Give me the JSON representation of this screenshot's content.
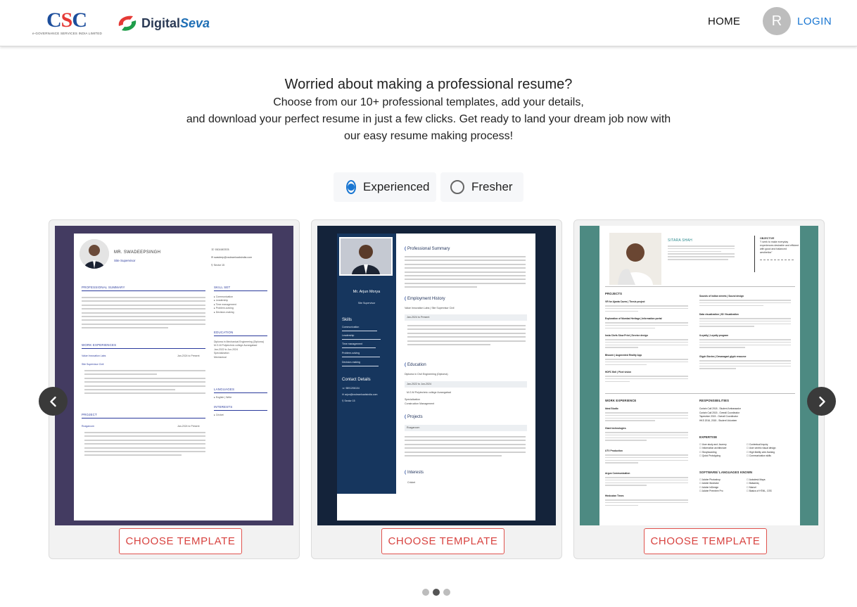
{
  "nav": {
    "csc_logo": "CSC",
    "csc_logo_sub": "e-GOVERNANCE SERVICES INDIA LIMITED",
    "digitalseva_brand": "Digital",
    "digitalseva_brand_accent": "Seva",
    "home_label": "HOME",
    "avatar_initial": "R",
    "login_label": "LOGIN"
  },
  "hero": {
    "title": "Worried about making a professional resume?",
    "line1": "Choose from our 10+ professional templates, add your details,",
    "line2": "and download your perfect resume in just a few clicks. Get ready to land your dream job now with",
    "line3": "our easy resume making process!"
  },
  "experience_toggle": {
    "options": [
      {
        "label": "Experienced",
        "selected": true
      },
      {
        "label": "Fresher",
        "selected": false
      }
    ]
  },
  "templates": [
    {
      "button_label": "CHOOSE TEMPLATE",
      "preview": {
        "name": "MR. SWADEEPSINGH",
        "role": "Site Supervisor",
        "phone": "9301987878",
        "email": "swadeep@csdownloadsindia.com",
        "location": "Sector 15",
        "sections": {
          "summary": "PROFESSIONAL SUMMARY",
          "experience": "WORK EXPERIENCES",
          "project": "PROJECT",
          "skills": "SKILL SET",
          "education": "EDUCATION",
          "languages": "LANGUAGES",
          "interests": "INTERESTS"
        },
        "company": "Value Innovation Labs",
        "company_dates": "Jan-2024 to Present",
        "job_title": "Site Supervisor Civil",
        "project_name": "Rozgarcom",
        "project_dates": "Jan-2024 to Present",
        "skills": [
          "Communication",
          "Leadership",
          "Time management",
          "Problem-solving",
          "Decision-making"
        ],
        "education": [
          "Diploma in Mechanical Engineering (Diploma)",
          "M.G.M Polytechnic college Aurangabad",
          "Jan-2022 to Jun-2024",
          "Specialization",
          "Mechanical"
        ],
        "language_item": "English | Write",
        "interest_item": "Cricket"
      }
    },
    {
      "button_label": "CHOOSE TEMPLATE",
      "preview": {
        "name": "Mr. Arjun Morya",
        "role": "Site Supervisor",
        "skills_heading": "Skills",
        "skills": [
          "Communication",
          "Leadership",
          "Time management",
          "Problem-solving",
          "Decision-making"
        ],
        "contact_heading": "Contact Details",
        "contact": [
          "9891206104",
          "arjun@csdownloadsindia.com",
          "Sector 15"
        ],
        "summary_heading": "Professional Summary",
        "history_heading": "Employment History",
        "company": "Value Innovation Labs | Site Supervisor Civil",
        "company_dates": "Jan-2024 to Present",
        "education_heading": "Education",
        "degree": "Diploma in Civil Engineering (Diploma)",
        "edu_dates": "Jan-2022 to Jun-2024",
        "college": "M.G.M Polytechnic college Aurangabad",
        "specialization_label": "Specialization",
        "specialization": "Construction Management",
        "projects_heading": "Projects",
        "project_name": "Rozgarcom",
        "interests_heading": "Interests",
        "interest": "Cricket"
      }
    },
    {
      "button_label": "CHOOSE TEMPLATE",
      "preview": {
        "name": "SITARA SHAH",
        "objective_heading": "OBJECTIVE",
        "objective": "\"I seek to make everyday experiences desirable and efficient with good and balanced aesthetics\"",
        "projects_heading": "PROJECTS",
        "projects_left": [
          "VR for Ajanta Caves | Thesis project",
          "Exploration of Mumbai Heritage | Information portal",
          "Insta Chefs Slow Print | Service design",
          "Bhoomi | Augmented Reality App",
          "HDFC Bell | Pixel vision"
        ],
        "projects_right": [
          "Sounds of Indian streets | Sound design",
          "Data visualization | 3D Visualization",
          "iLoyalty | Loyalty program",
          "Glyph Stories | Devanagari glyph resource"
        ],
        "work_heading": "WORK EXPERIENCE",
        "work_items": [
          "Ideal Studio",
          "Giant technologies",
          "UTV Production",
          "Argus Communication",
          "Hindustan Times"
        ],
        "responsibilities_heading": "RESPONSIBILITIES",
        "responsibilities": [
          "Curtain Call 2018 - Student Ambassador",
          "Curtain Call 2015 - Overall Coordinator",
          "Tapestrize 2015 - Overall Coordinator",
          "HKS 2016, 2015 - Student Volunteer"
        ],
        "expertise_heading": "EXPERTISE",
        "expertise": [
          "User study and Journey",
          "Contextual Inquiry",
          "Information architecture",
          "User centric visual design",
          "Storyboarding",
          "High fidelity wire-framing",
          "Quick Prototyping",
          "Communication skills"
        ],
        "software_heading": "SOFTWARE/ LANGUAGES KNOWN",
        "software": [
          "Adobe Photoshop",
          "Autodesk Maya",
          "Adobe Illustrator",
          "Balsamiq",
          "Adobe InDesign",
          "Marvel",
          "Adobe Premiere Pro",
          "Basics of HTML, CSS"
        ]
      }
    }
  ],
  "carousel": {
    "prev_icon": "chevron-left-icon",
    "next_icon": "chevron-right-icon",
    "pages": 3,
    "active_page": 2
  },
  "colors": {
    "primary": "#1976d2",
    "button_red": "#d84340",
    "resume1_bg": "#433b61",
    "resume2_bg": "#14233a",
    "resume3_bg": "#4d8a82"
  }
}
